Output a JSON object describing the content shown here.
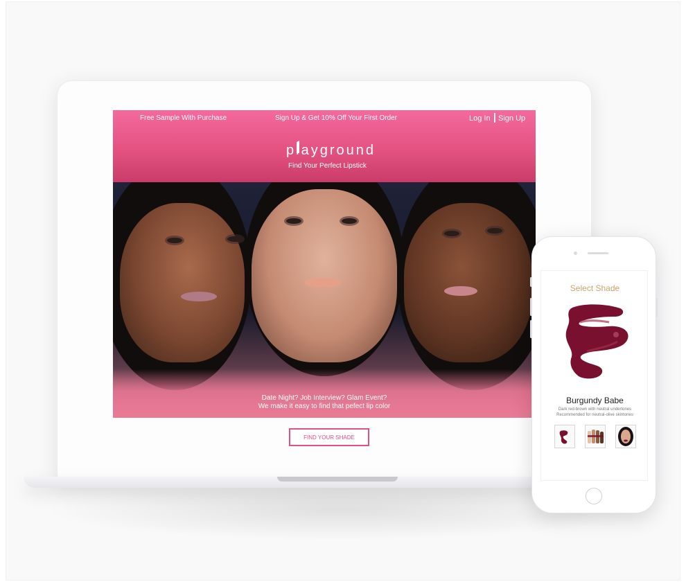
{
  "website": {
    "topbar": {
      "promo_left": "Free Sample With Purchase",
      "promo_center": "Sign Up & Get 10% Off Your First Order",
      "login_label": "Log In",
      "signup_label": "Sign Up"
    },
    "logo_text": "playground",
    "tagline": "Find Your Perfect Lipstick",
    "hero_line1": "Date Night? Job Interview? Glam Event?",
    "hero_line2": "We make it easy to find that pefect lip color",
    "cta_label": "FIND YOUR SHADE",
    "colors": {
      "brand_pink": "#e2507f",
      "header_gradient_top": "#f46a9c"
    }
  },
  "phone": {
    "title": "Select Shade",
    "shade_name": "Burgundy Babe",
    "shade_desc_1": "Dark red-brown with neutral undertones",
    "shade_desc_2": "Recommended for neutral-olive skintones",
    "thumbnails": [
      "swatch",
      "skin-tones",
      "model"
    ],
    "colors": {
      "title_gold": "#c9a46b",
      "shade": "#7a1030"
    }
  }
}
